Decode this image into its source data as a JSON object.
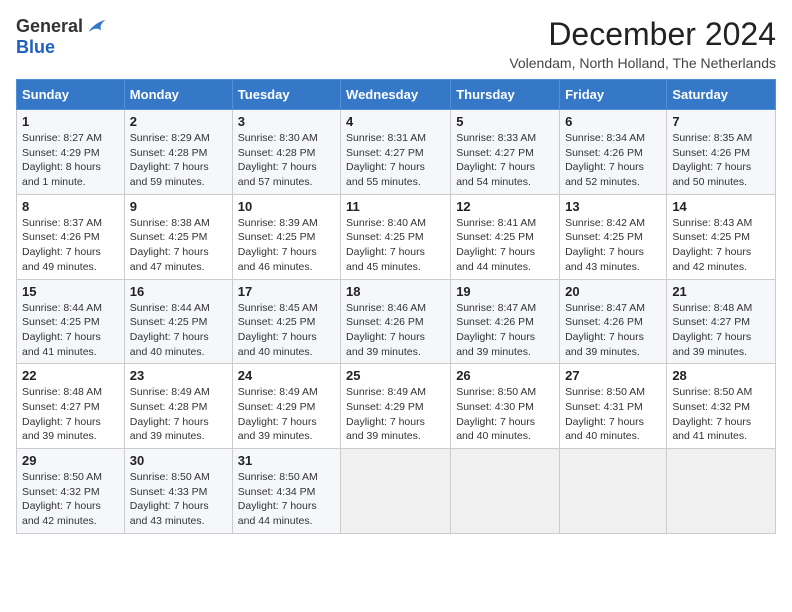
{
  "logo": {
    "general": "General",
    "blue": "Blue"
  },
  "title": "December 2024",
  "location": "Volendam, North Holland, The Netherlands",
  "days_of_week": [
    "Sunday",
    "Monday",
    "Tuesday",
    "Wednesday",
    "Thursday",
    "Friday",
    "Saturday"
  ],
  "weeks": [
    [
      {
        "day": "1",
        "info": "Sunrise: 8:27 AM\nSunset: 4:29 PM\nDaylight: 8 hours\nand 1 minute."
      },
      {
        "day": "2",
        "info": "Sunrise: 8:29 AM\nSunset: 4:28 PM\nDaylight: 7 hours\nand 59 minutes."
      },
      {
        "day": "3",
        "info": "Sunrise: 8:30 AM\nSunset: 4:28 PM\nDaylight: 7 hours\nand 57 minutes."
      },
      {
        "day": "4",
        "info": "Sunrise: 8:31 AM\nSunset: 4:27 PM\nDaylight: 7 hours\nand 55 minutes."
      },
      {
        "day": "5",
        "info": "Sunrise: 8:33 AM\nSunset: 4:27 PM\nDaylight: 7 hours\nand 54 minutes."
      },
      {
        "day": "6",
        "info": "Sunrise: 8:34 AM\nSunset: 4:26 PM\nDaylight: 7 hours\nand 52 minutes."
      },
      {
        "day": "7",
        "info": "Sunrise: 8:35 AM\nSunset: 4:26 PM\nDaylight: 7 hours\nand 50 minutes."
      }
    ],
    [
      {
        "day": "8",
        "info": "Sunrise: 8:37 AM\nSunset: 4:26 PM\nDaylight: 7 hours\nand 49 minutes."
      },
      {
        "day": "9",
        "info": "Sunrise: 8:38 AM\nSunset: 4:25 PM\nDaylight: 7 hours\nand 47 minutes."
      },
      {
        "day": "10",
        "info": "Sunrise: 8:39 AM\nSunset: 4:25 PM\nDaylight: 7 hours\nand 46 minutes."
      },
      {
        "day": "11",
        "info": "Sunrise: 8:40 AM\nSunset: 4:25 PM\nDaylight: 7 hours\nand 45 minutes."
      },
      {
        "day": "12",
        "info": "Sunrise: 8:41 AM\nSunset: 4:25 PM\nDaylight: 7 hours\nand 44 minutes."
      },
      {
        "day": "13",
        "info": "Sunrise: 8:42 AM\nSunset: 4:25 PM\nDaylight: 7 hours\nand 43 minutes."
      },
      {
        "day": "14",
        "info": "Sunrise: 8:43 AM\nSunset: 4:25 PM\nDaylight: 7 hours\nand 42 minutes."
      }
    ],
    [
      {
        "day": "15",
        "info": "Sunrise: 8:44 AM\nSunset: 4:25 PM\nDaylight: 7 hours\nand 41 minutes."
      },
      {
        "day": "16",
        "info": "Sunrise: 8:44 AM\nSunset: 4:25 PM\nDaylight: 7 hours\nand 40 minutes."
      },
      {
        "day": "17",
        "info": "Sunrise: 8:45 AM\nSunset: 4:25 PM\nDaylight: 7 hours\nand 40 minutes."
      },
      {
        "day": "18",
        "info": "Sunrise: 8:46 AM\nSunset: 4:26 PM\nDaylight: 7 hours\nand 39 minutes."
      },
      {
        "day": "19",
        "info": "Sunrise: 8:47 AM\nSunset: 4:26 PM\nDaylight: 7 hours\nand 39 minutes."
      },
      {
        "day": "20",
        "info": "Sunrise: 8:47 AM\nSunset: 4:26 PM\nDaylight: 7 hours\nand 39 minutes."
      },
      {
        "day": "21",
        "info": "Sunrise: 8:48 AM\nSunset: 4:27 PM\nDaylight: 7 hours\nand 39 minutes."
      }
    ],
    [
      {
        "day": "22",
        "info": "Sunrise: 8:48 AM\nSunset: 4:27 PM\nDaylight: 7 hours\nand 39 minutes."
      },
      {
        "day": "23",
        "info": "Sunrise: 8:49 AM\nSunset: 4:28 PM\nDaylight: 7 hours\nand 39 minutes."
      },
      {
        "day": "24",
        "info": "Sunrise: 8:49 AM\nSunset: 4:29 PM\nDaylight: 7 hours\nand 39 minutes."
      },
      {
        "day": "25",
        "info": "Sunrise: 8:49 AM\nSunset: 4:29 PM\nDaylight: 7 hours\nand 39 minutes."
      },
      {
        "day": "26",
        "info": "Sunrise: 8:50 AM\nSunset: 4:30 PM\nDaylight: 7 hours\nand 40 minutes."
      },
      {
        "day": "27",
        "info": "Sunrise: 8:50 AM\nSunset: 4:31 PM\nDaylight: 7 hours\nand 40 minutes."
      },
      {
        "day": "28",
        "info": "Sunrise: 8:50 AM\nSunset: 4:32 PM\nDaylight: 7 hours\nand 41 minutes."
      }
    ],
    [
      {
        "day": "29",
        "info": "Sunrise: 8:50 AM\nSunset: 4:32 PM\nDaylight: 7 hours\nand 42 minutes."
      },
      {
        "day": "30",
        "info": "Sunrise: 8:50 AM\nSunset: 4:33 PM\nDaylight: 7 hours\nand 43 minutes."
      },
      {
        "day": "31",
        "info": "Sunrise: 8:50 AM\nSunset: 4:34 PM\nDaylight: 7 hours\nand 44 minutes."
      },
      null,
      null,
      null,
      null
    ]
  ]
}
